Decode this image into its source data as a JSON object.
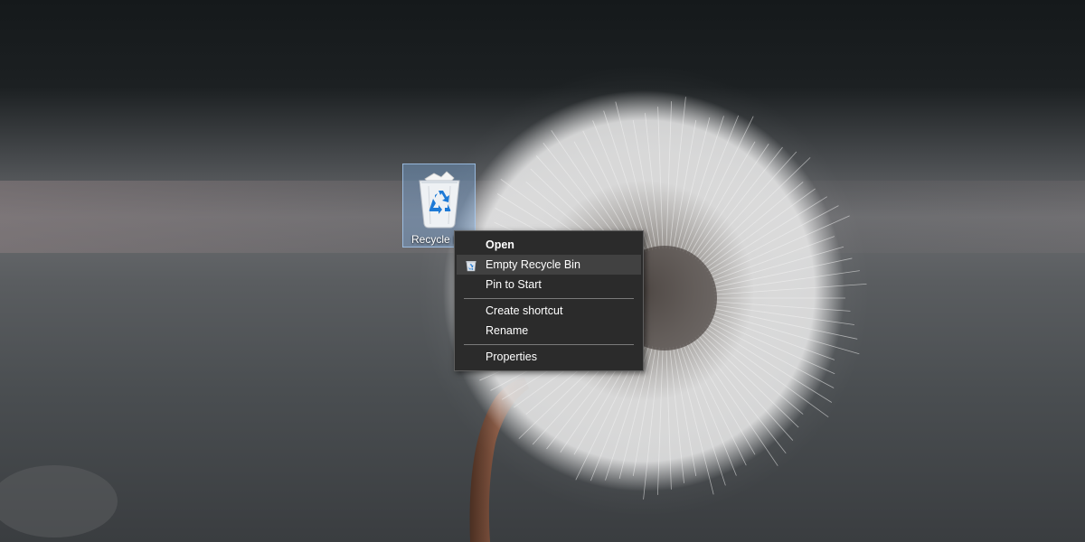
{
  "desktop": {
    "icons": [
      {
        "label": "Recycle B",
        "icon": "recycle-bin-full-icon",
        "selected": true
      }
    ]
  },
  "context_menu": {
    "items": [
      {
        "label": "Open",
        "bold": true
      },
      {
        "label": "Empty Recycle Bin",
        "icon": "recycle-bin-icon",
        "highlighted": true
      },
      {
        "label": "Pin to Start"
      },
      {
        "label": "Create shortcut"
      },
      {
        "label": "Rename"
      },
      {
        "label": "Properties"
      }
    ]
  },
  "colors": {
    "menu_background": "#2b2b2b",
    "menu_highlight": "#414141",
    "menu_text": "#ffffff",
    "selection_fill": "#7caee6",
    "recycle_arrows": "#1e7ad6"
  }
}
